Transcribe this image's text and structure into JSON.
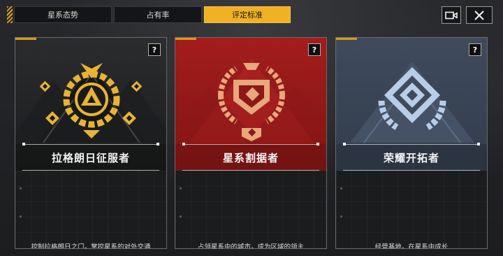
{
  "tabs": [
    {
      "label": "星系态势",
      "active": false
    },
    {
      "label": "占有率",
      "active": false
    },
    {
      "label": "评定标准",
      "active": true
    }
  ],
  "toolbar": {
    "video_icon": "video-camera-icon",
    "close_icon": "close-icon"
  },
  "cards": [
    {
      "title": "拉格朗日征服者",
      "description": "控制拉格朗日之门，掌控星系的对外交通",
      "help": "?",
      "accent": "#e8b431",
      "background": "#2b2c2e",
      "emblem": "golden-triangle-gear-emblem"
    },
    {
      "title": "星系割据者",
      "description": "占领星系中的城市，成为区域的领主",
      "help": "?",
      "accent": "#e7a87a",
      "background": "#a41d1d",
      "emblem": "red-gear-crest-emblem"
    },
    {
      "title": "荣耀开拓者",
      "description": "经营基地，在星系中成长",
      "help": "?",
      "accent": "#b8cde8",
      "background": "#3f4b5d",
      "emblem": "blue-diamond-gear-emblem"
    }
  ]
}
